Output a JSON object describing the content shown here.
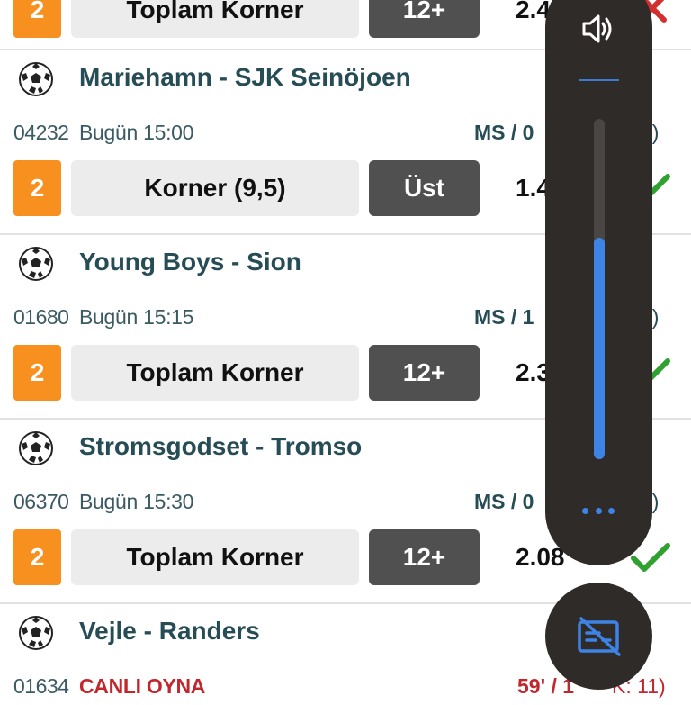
{
  "colors": {
    "accent_orange": "#f7901e",
    "team_text": "#264c55",
    "live_red": "#c0282d",
    "check_green": "#2fa12f",
    "cross_red": "#d32f2f",
    "volume_fill": "#3d84e6",
    "overlay_bg": "#2f2b28"
  },
  "top_partial": {
    "number": "2",
    "market": "Toplam Korner",
    "pick": "12+",
    "odds": "2.4",
    "result_icon": "cross-icon"
  },
  "matches": [
    {
      "teams": "Mariehamn - SJK Seinöjoen",
      "code": "04232",
      "time": "Bugün 15:00",
      "ms": "MS / 0",
      "ms_tail": "2)",
      "number": "2",
      "market": "Korner (9,5)",
      "pick": "Üst",
      "odds": "1.4",
      "result_icon": "check-icon"
    },
    {
      "teams": "Young Boys - Sion",
      "code": "01680",
      "time": "Bugün 15:15",
      "ms": "MS / 1",
      "ms_tail": "5)",
      "number": "2",
      "market": "Toplam Korner",
      "pick": "12+",
      "odds": "2.3",
      "result_icon": "check-icon"
    },
    {
      "teams": "Stromsgodset - Tromso",
      "code": "06370",
      "time": "Bugün 15:30",
      "ms": "MS / 0",
      "ms_tail": "2)",
      "number": "2",
      "market": "Toplam Korner",
      "pick": "12+",
      "odds": "2.08",
      "result_icon": "check-icon"
    },
    {
      "teams": "Vejle - Randers",
      "code": "01634",
      "time": "CANLI OYNA",
      "ms": "59' / 1",
      "ms_tail": "K: 11)"
    }
  ],
  "volume": {
    "icon": "speaker-icon",
    "level_percent": 65,
    "more_icon": "more-dots-icon",
    "caption_icon": "captions-off-icon"
  }
}
